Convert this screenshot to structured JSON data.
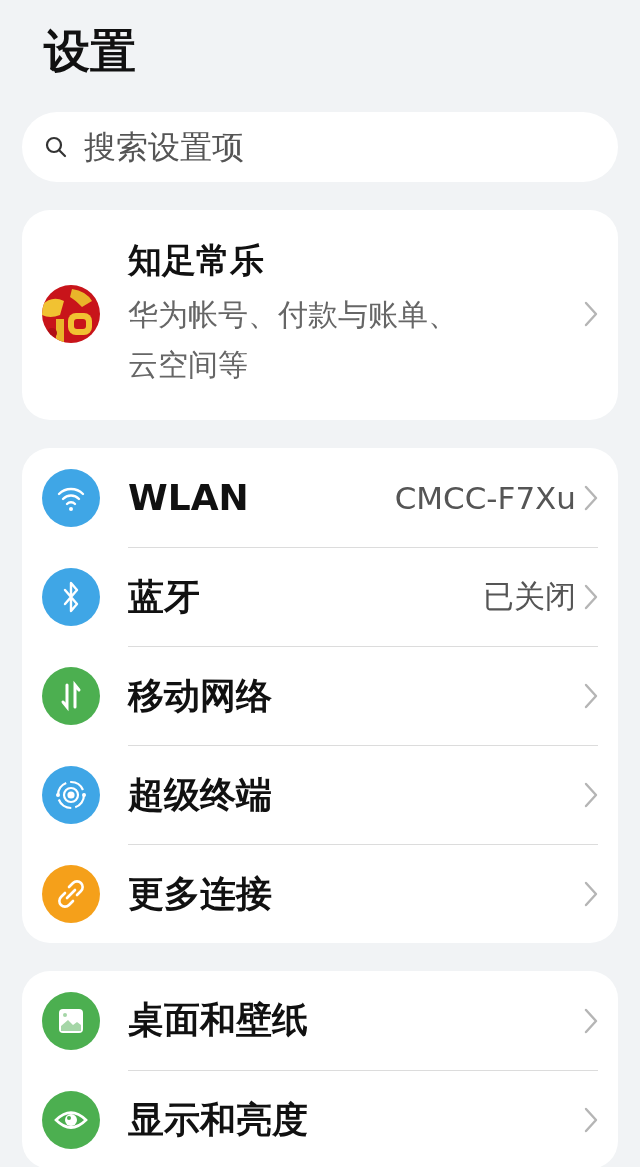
{
  "title": "设置",
  "search": {
    "placeholder": "搜索设置项"
  },
  "account": {
    "name": "知足常乐",
    "subtitle": "华为帐号、付款与账单、云空间等"
  },
  "groups": [
    {
      "items": [
        {
          "kind": "wifi",
          "label": "WLAN",
          "value": "CMCC-F7Xu"
        },
        {
          "kind": "bluetooth",
          "label": "蓝牙",
          "value": "已关闭"
        },
        {
          "kind": "mobile",
          "label": "移动网络"
        },
        {
          "kind": "terminal",
          "label": "超级终端"
        },
        {
          "kind": "link",
          "label": "更多连接"
        }
      ]
    },
    {
      "items": [
        {
          "kind": "wallpaper",
          "label": "桌面和壁纸"
        },
        {
          "kind": "display",
          "label": "显示和亮度"
        }
      ]
    }
  ]
}
